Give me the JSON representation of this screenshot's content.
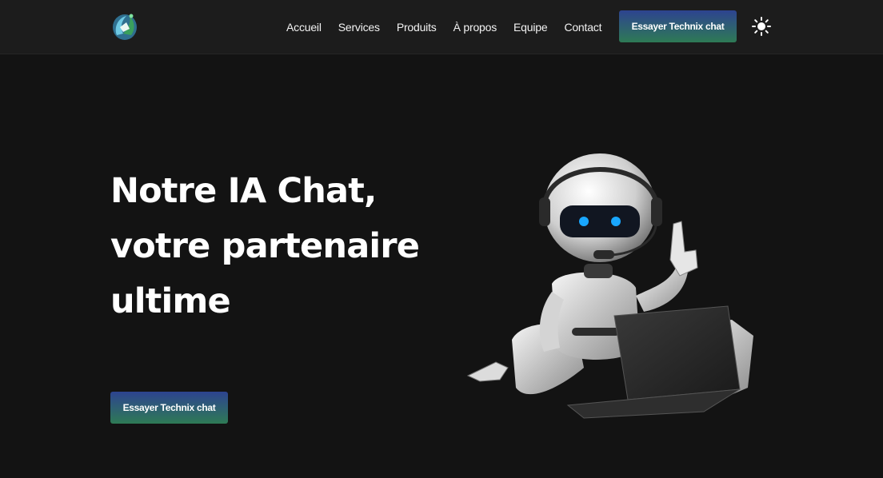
{
  "header": {
    "logo": "logo-icon",
    "nav": [
      {
        "label": "Accueil"
      },
      {
        "label": "Services"
      },
      {
        "label": "Produits"
      },
      {
        "label": "À propos"
      },
      {
        "label": "Equipe"
      },
      {
        "label": "Contact"
      }
    ],
    "cta_label": "Essayer Technix chat",
    "theme_icon": "sun-icon"
  },
  "hero": {
    "title_lines": [
      "Notre IA Chat,",
      "votre partenaire",
      "ultime"
    ],
    "cta_label": "Essayer Technix chat",
    "illustration": "robot-with-headset-and-laptop"
  },
  "colors": {
    "background": "#131313",
    "header_background": "#1c1c1c",
    "button_gradient_top": "#2d4390",
    "button_gradient_bottom": "#2e7a55",
    "robot_eye": "#19a7ff"
  }
}
